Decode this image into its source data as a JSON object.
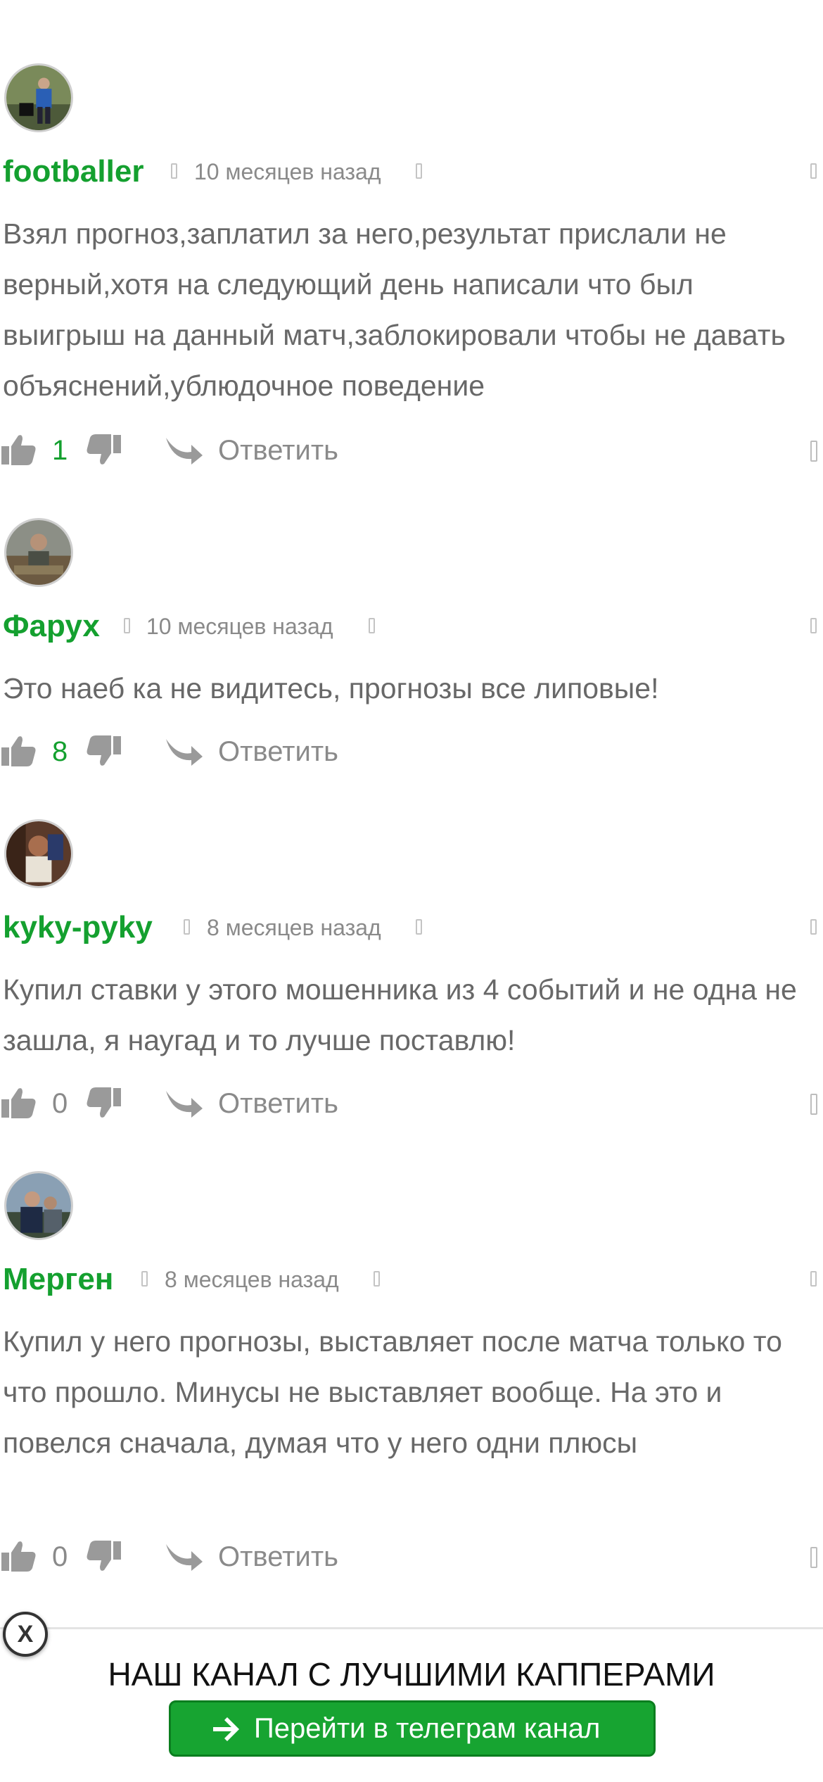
{
  "comments": [
    {
      "author": "footballer",
      "time": "10 месяцев назад",
      "text": "Взял прогноз,заплатил за него,результат прислали не верный,хотя на следующий день написали что был выигрыш на данный матч,заблокировали чтобы не давать объяснений,ублюдочное поведение",
      "votes": "1",
      "reply_label": "Ответить"
    },
    {
      "author": "Фарух",
      "time": "10 месяцев назад",
      "text": "Это наеб ка не видитесь, прогнозы все липовые!",
      "votes": "8",
      "reply_label": "Ответить"
    },
    {
      "author": "kyky-pyky",
      "time": "8 месяцев назад",
      "text": "Купил ставки у этого мошенника из 4 событий и не одна не зашла, я наугад и то лучше поставлю!",
      "votes": "0",
      "reply_label": "Ответить"
    },
    {
      "author": "Мерген",
      "time": "8 месяцев назад",
      "text": "Купил у него прогнозы, выставляет после матча только то что прошло. Минусы не выставляет вообще. На это и повелся сначала, думая что у него одни плюсы",
      "votes": "0",
      "reply_label": "Ответить"
    }
  ],
  "banner": {
    "close_label": "X",
    "title": "НАШ КАНАЛ С ЛУЧШИМИ КАППЕРАМИ",
    "button_label": "Перейти в телеграм канал"
  },
  "colors": {
    "author": "#14a02f",
    "positive_votes": "#14a02f",
    "button": "#17a431",
    "text": "#686868"
  },
  "icons": [
    "thumbs-up-icon",
    "thumbs-down-icon",
    "reply-arrow-icon",
    "arrow-right-icon",
    "close-icon"
  ]
}
